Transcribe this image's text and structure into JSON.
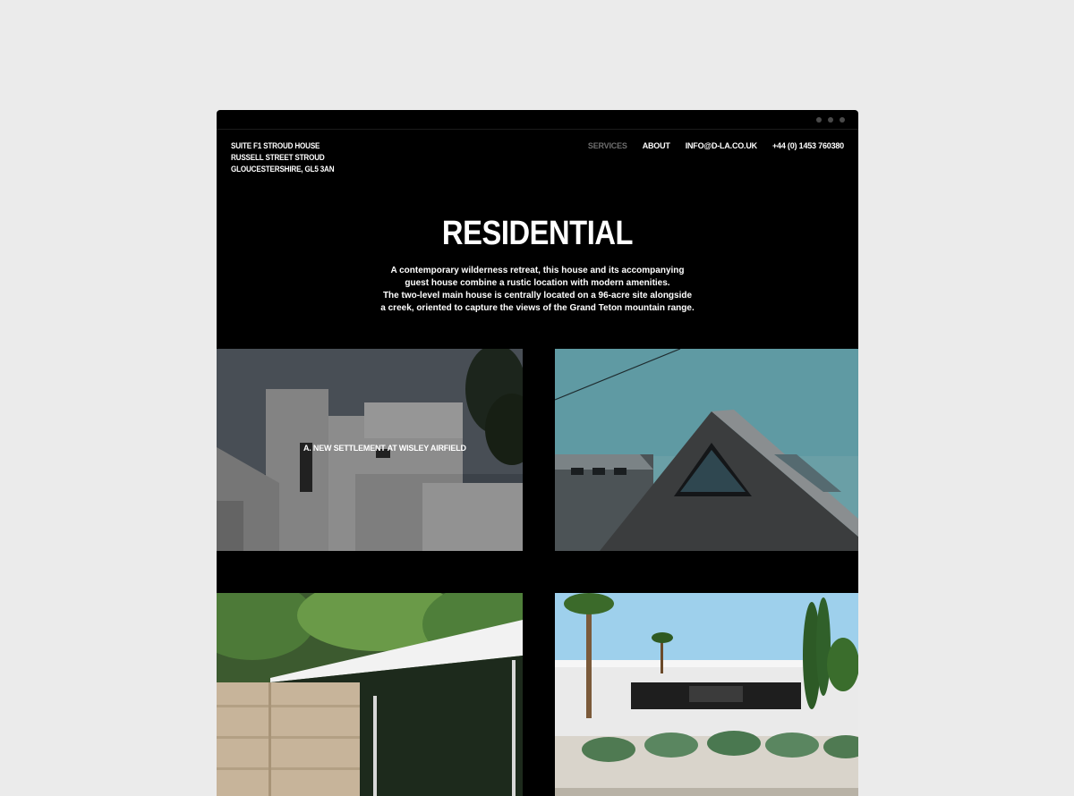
{
  "address": {
    "line1": "SUITE F1 STROUD HOUSE",
    "line2": "RUSSELL STREET STROUD",
    "line3": "GLOUCESTERSHIRE, GL5 3AN"
  },
  "nav": {
    "services": "SERVICES",
    "about": "ABOUT",
    "email": "INFO@D-LA.CO.UK",
    "phone": "+44 (0) 1453 760380",
    "active": "services"
  },
  "hero": {
    "title": "RESIDENTIAL",
    "desc1": "A contemporary wilderness retreat, this house and its accompanying",
    "desc2": "guest house combine a rustic location with modern amenities.",
    "desc3": "The two-level main house is centrally located on a 96-acre site alongside",
    "desc4": "a creek, oriented to capture the views of the Grand Teton mountain range."
  },
  "projects": [
    {
      "caption": "A. NEW SETTLEMENT AT WISLEY AIRFIELD",
      "hovered": true
    },
    {
      "caption": ""
    },
    {
      "caption": ""
    },
    {
      "caption": ""
    }
  ],
  "colors": {
    "page_bg": "#ebebeb",
    "window_bg": "#000000",
    "nav_active": "#6e6e6e",
    "text": "#ffffff"
  }
}
